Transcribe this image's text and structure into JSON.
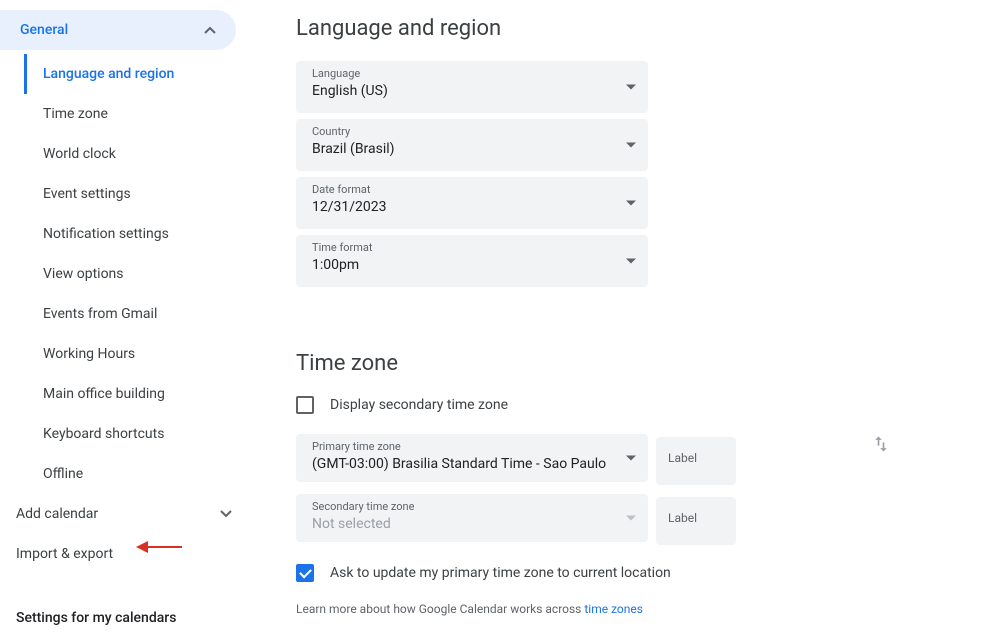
{
  "sidebar": {
    "general_label": "General",
    "items": [
      "Language and region",
      "Time zone",
      "World clock",
      "Event settings",
      "Notification settings",
      "View options",
      "Events from Gmail",
      "Working Hours",
      "Main office building",
      "Keyboard shortcuts",
      "Offline"
    ],
    "add_calendar": "Add calendar",
    "import_export": "Import & export",
    "settings_calendars": "Settings for my calendars"
  },
  "lang_region": {
    "title": "Language and region",
    "language_label": "Language",
    "language_value": "English (US)",
    "country_label": "Country",
    "country_value": "Brazil (Brasil)",
    "dateformat_label": "Date format",
    "dateformat_value": "12/31/2023",
    "timeformat_label": "Time format",
    "timeformat_value": "1:00pm"
  },
  "timezone": {
    "title": "Time zone",
    "secondary_checkbox": "Display secondary time zone",
    "primary_label": "Primary time zone",
    "primary_value": "(GMT-03:00) Brasilia Standard Time - Sao Paulo",
    "secondary_label": "Secondary time zone",
    "secondary_value": "Not selected",
    "label_placeholder": "Label",
    "ask_update": "Ask to update my primary time zone to current location",
    "help_prefix": "Learn more about how Google Calendar works across ",
    "help_link": "time zones"
  }
}
